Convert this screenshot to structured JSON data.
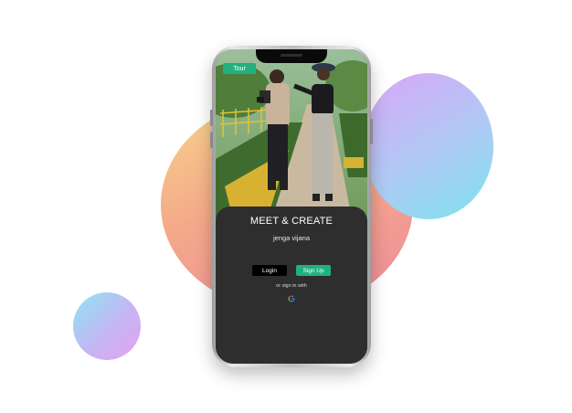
{
  "colors": {
    "accent": "#22b07d",
    "panel": "#2e2e2e",
    "login_bg": "#000000"
  },
  "tour": {
    "label": "Tour"
  },
  "hero": {
    "headline": "MEET & CREATE",
    "tagline": "jenga vijana"
  },
  "auth": {
    "login_label": "Login",
    "signup_label": "Sign Up",
    "alt_label": "or sign in with",
    "google_icon": "google-g-icon"
  }
}
